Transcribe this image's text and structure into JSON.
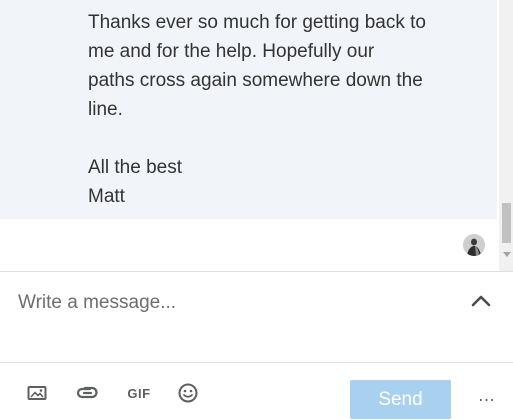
{
  "thread": {
    "message_text": "Thanks ever so much for getting back to\nme and for the help. Hopefully our\npaths cross again somewhere down the\nline.\n\nAll the best\nMatt"
  },
  "compose": {
    "placeholder": "Write a message..."
  },
  "toolbar": {
    "gif_label": "GIF",
    "send_label": "Send",
    "more_label": "…"
  },
  "icons": {
    "image": "image-icon",
    "attach": "paperclip-icon",
    "gif": "gif-icon",
    "emoji": "emoji-icon",
    "expand": "chevron-up-icon",
    "more": "more-horizontal-icon"
  },
  "colors": {
    "message_bg": "#f1f4f8",
    "send_disabled": "#a8d1ef",
    "icon": "#5e5f61"
  }
}
